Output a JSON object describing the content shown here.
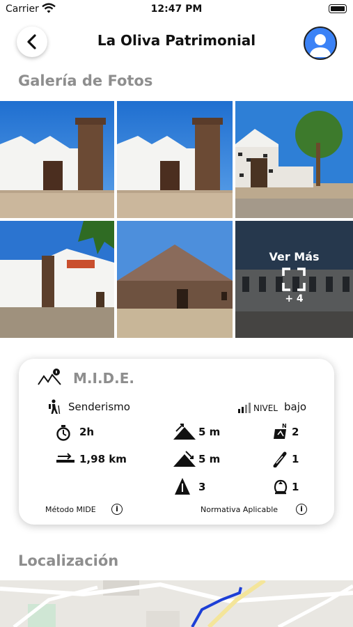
{
  "status_bar": {
    "carrier": "Carrier",
    "time": "12:47 PM"
  },
  "header": {
    "title": "La Oliva Patrimonial"
  },
  "gallery": {
    "title": "Galería de Fotos",
    "more_label": "Ver Más",
    "more_count": "+ 4"
  },
  "mide": {
    "title": "M.I.D.E.",
    "activity": "Senderismo",
    "level_label": "NIVEL",
    "level_value": "bajo",
    "duration": "2h",
    "distance": "1,98 km",
    "ascent": "5 m",
    "descent": "5 m",
    "difficulty": "3",
    "environment": "2",
    "orientation": "1",
    "effort": "1",
    "method_link": "Método MIDE",
    "norm_link": "Normativa Aplicable"
  },
  "location": {
    "title": "Localización"
  },
  "colors": {
    "accent": "#3b82f6",
    "section_gray": "#8e8e8e",
    "route": "#1d3fd6"
  }
}
